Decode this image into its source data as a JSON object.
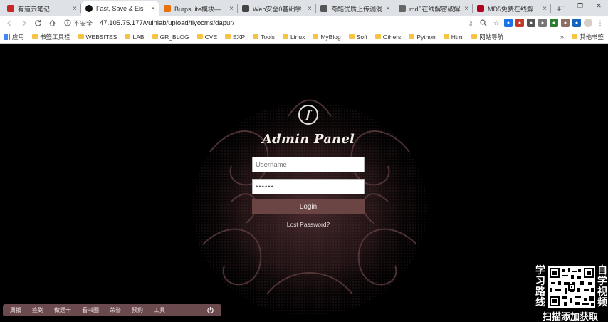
{
  "browser": {
    "tabs": [
      {
        "label": "有道云笔记",
        "favicon_color": "#c62828",
        "active": false
      },
      {
        "label": "Fast, Save & Eis",
        "favicon_color": "#111111",
        "active": true
      },
      {
        "label": "Burpsuite模块—",
        "favicon_color": "#e8710a",
        "active": false
      },
      {
        "label": "Web安全0基础学",
        "favicon_color": "#444444",
        "active": false
      },
      {
        "label": "奇酷优质上传漏洞",
        "favicon_color": "#555555",
        "active": false
      },
      {
        "label": "md5在线解密破解",
        "favicon_color": "#666666",
        "active": false
      },
      {
        "label": "MD5免费在线解",
        "favicon_color": "#b00020",
        "active": false
      }
    ],
    "tab_close": "×",
    "new_tab": "+",
    "window_controls": {
      "minimize": "—",
      "restore": "❐",
      "close": "✕"
    },
    "security_label": "不安全",
    "url": "47.105.75.177/vulnlab/upload/fiyocms/dapur/"
  },
  "bookmarks": [
    {
      "label": "应用",
      "icon": "apps-grid-icon"
    },
    {
      "label": "书签工具栏",
      "icon": "folder-icon"
    },
    {
      "label": "WEBSITES",
      "icon": "folder-icon"
    },
    {
      "label": "LAB",
      "icon": "folder-icon"
    },
    {
      "label": "GR_BLOG",
      "icon": "folder-icon"
    },
    {
      "label": "CVE",
      "icon": "folder-icon"
    },
    {
      "label": "EXP",
      "icon": "folder-icon"
    },
    {
      "label": "Tools",
      "icon": "folder-icon"
    },
    {
      "label": "Linux",
      "icon": "folder-icon"
    },
    {
      "label": "MyBlog",
      "icon": "folder-icon"
    },
    {
      "label": "Soft",
      "icon": "folder-icon"
    },
    {
      "label": "Others",
      "icon": "folder-icon"
    },
    {
      "label": "Python",
      "icon": "folder-icon"
    },
    {
      "label": "Html",
      "icon": "folder-icon"
    },
    {
      "label": "网站导航",
      "icon": "folder-icon"
    }
  ],
  "bookmarks_more": "»",
  "bookmarks_other": "其他书签",
  "login": {
    "logo_glyph": "f",
    "title": "Admin Panel",
    "username_placeholder": "Username",
    "password_value": "••••••",
    "login_button": "Login",
    "forgot_link": "Lost Password?"
  },
  "dock": {
    "items": [
      "周报",
      "签到",
      "做题卡",
      "看书圈",
      "荣誉",
      "预约",
      "工具"
    ],
    "power_icon": "power-icon"
  },
  "watermark": {
    "left": [
      "学",
      "习",
      "路",
      "线"
    ],
    "right": [
      "自",
      "学",
      "视",
      "频"
    ],
    "bottom": "扫描添加获取"
  },
  "colors": {
    "login_button": "#6b4444",
    "dock": "#6a4a4d",
    "page_bg": "#000000"
  }
}
